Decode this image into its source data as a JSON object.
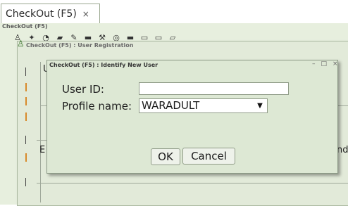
{
  "tab": {
    "label": "CheckOut (F5)",
    "close": "×"
  },
  "app": {
    "title": "CheckOut (F5)"
  },
  "registration": {
    "title": "CheckOut (F5) : User Registration",
    "fragments": {
      "u": "U",
      "e": "E",
      "nd": "nd"
    }
  },
  "dialog": {
    "title": "CheckOut (F5) : Identify New User",
    "controls": {
      "minimize": "–",
      "maximize": "□",
      "close": "×"
    },
    "user_id": {
      "label": "User ID:",
      "value": ""
    },
    "profile": {
      "label": "Profile name:",
      "value": "WARADULT"
    },
    "buttons": {
      "ok": "OK",
      "cancel": "Cancel"
    }
  },
  "icons": {
    "user_icon": "user-icon",
    "toolbar": [
      "user-icon",
      "person-icon",
      "star-icon",
      "spectacles-icon",
      "car-icon",
      "pencil-icon",
      "book-icon",
      "tools-icon",
      "binoculars-icon",
      "chart-icon",
      "window-icon",
      "window-icon",
      "document-icon"
    ]
  }
}
